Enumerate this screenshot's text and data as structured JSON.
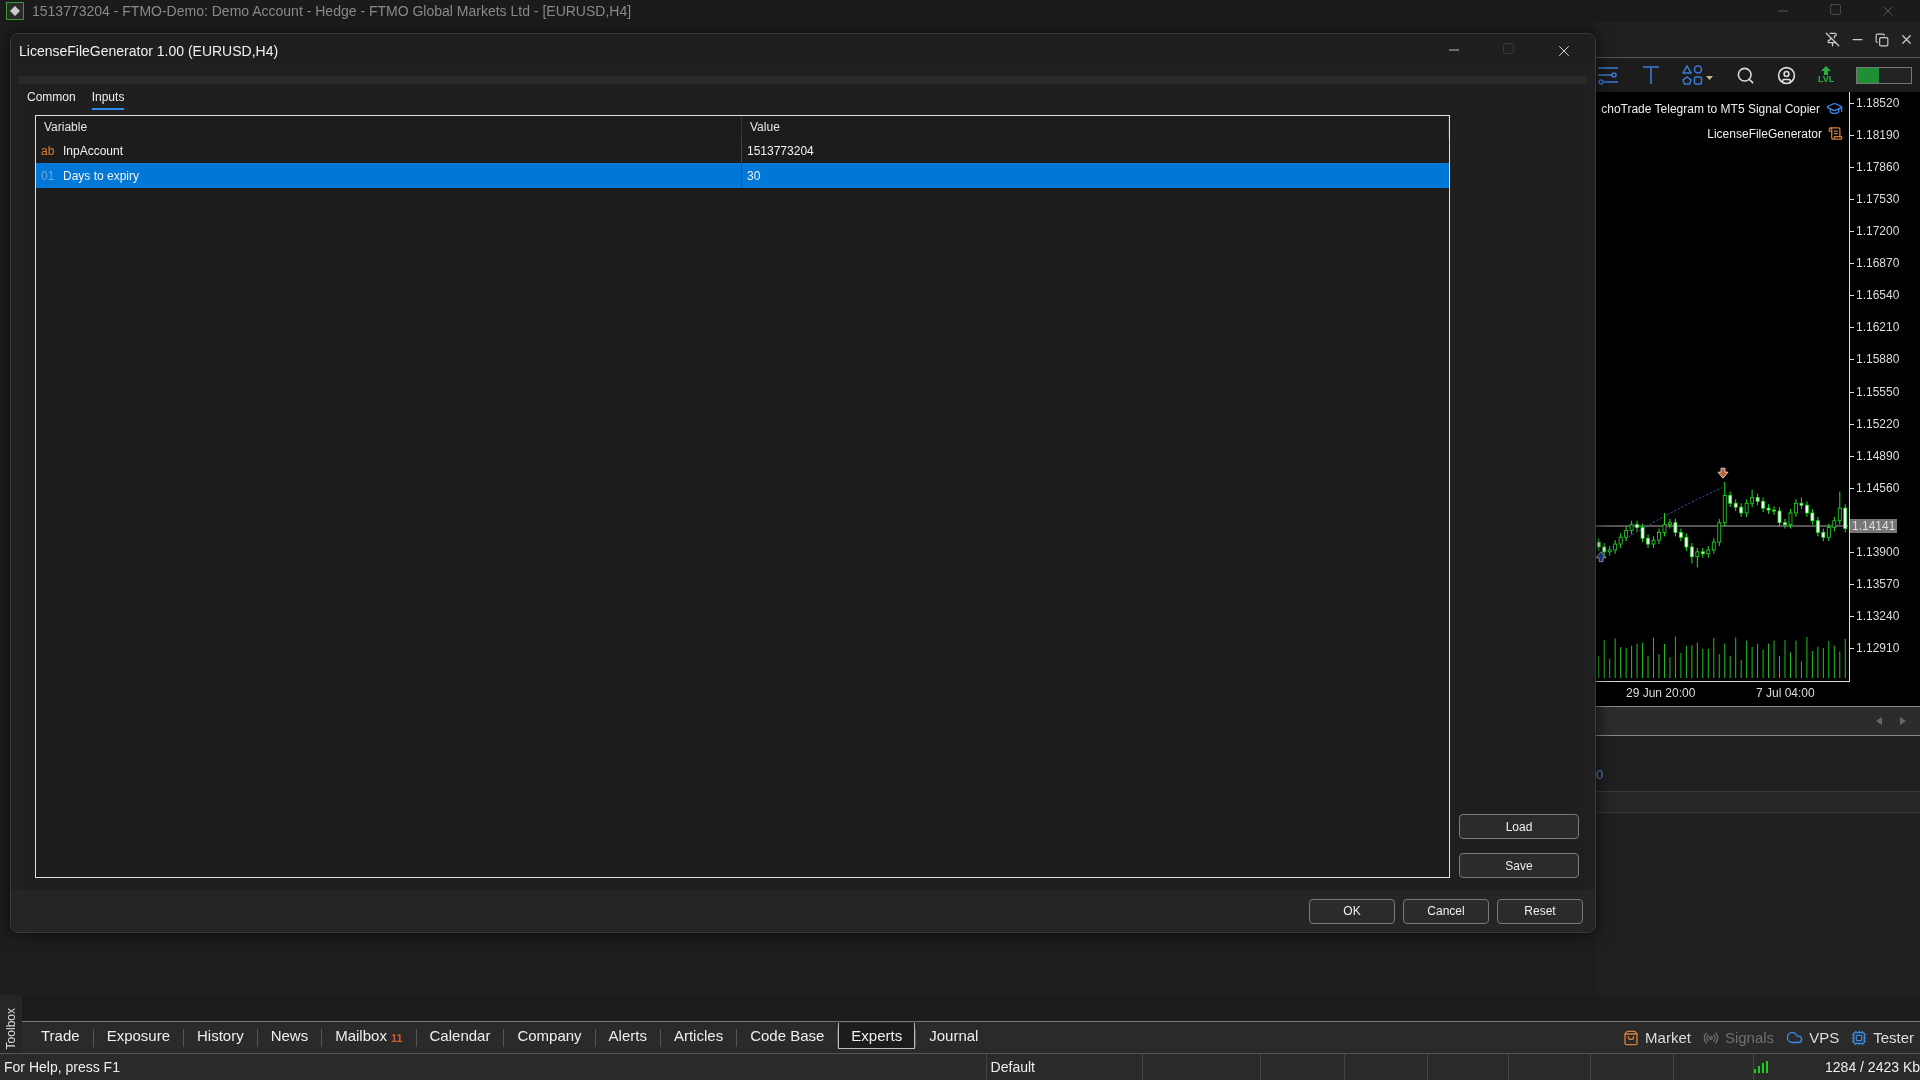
{
  "app_window": {
    "title": "1513773204 - FTMO-Demo: Demo Account - Hedge - FTMO Global Markets Ltd - [EURUSD,H4]"
  },
  "dialog": {
    "title": "LicenseFileGenerator 1.00 (EURUSD,H4)",
    "tabs": [
      {
        "label": "Common",
        "selected": false
      },
      {
        "label": "Inputs",
        "selected": true
      }
    ],
    "table": {
      "columns": [
        "Variable",
        "Value"
      ],
      "rows": [
        {
          "kind": "text",
          "type_label": "ab",
          "variable": "InpAccount",
          "value": "1513773204",
          "selected": false
        },
        {
          "kind": "integer",
          "type_label": "01",
          "variable": "Days to expiry",
          "value": "30",
          "selected": true
        }
      ]
    },
    "side_buttons": [
      "Load",
      "Save"
    ],
    "buttons": [
      "OK",
      "Cancel",
      "Reset"
    ]
  },
  "chart_window": {
    "toolbar": {
      "lvl_label": "LVL",
      "meter": {
        "level": 0.4
      }
    },
    "legend": [
      {
        "kind": "hat",
        "text": "choTrade Telegram to MT5 Signal Copier"
      },
      {
        "kind": "scroll",
        "text": "LicenseFileGenerator"
      }
    ],
    "time_axis": [
      "29 Jun 20:00",
      "7 Jul 04:00"
    ],
    "current_price": "1.14141",
    "chart_data": {
      "type": "candlestick",
      "ylim": [
        1.12581,
        1.18633
      ],
      "yticks": [
        {
          "value": 1.1852,
          "label": "1.18520"
        },
        {
          "value": 1.1819,
          "label": "1.18190"
        },
        {
          "value": 1.1786,
          "label": "1.17860"
        },
        {
          "value": 1.1753,
          "label": "1.17530"
        },
        {
          "value": 1.172,
          "label": "1.17200"
        },
        {
          "value": 1.1687,
          "label": "1.16870"
        },
        {
          "value": 1.1654,
          "label": "1.16540"
        },
        {
          "value": 1.1621,
          "label": "1.16210"
        },
        {
          "value": 1.1588,
          "label": "1.15880"
        },
        {
          "value": 1.1555,
          "label": "1.15550"
        },
        {
          "value": 1.1522,
          "label": "1.15220"
        },
        {
          "value": 1.1489,
          "label": "1.14890"
        },
        {
          "value": 1.1456,
          "label": "1.14560"
        },
        {
          "value": 1.139,
          "label": "1.13900"
        },
        {
          "value": 1.1357,
          "label": "1.13570"
        },
        {
          "value": 1.1324,
          "label": "1.13240"
        },
        {
          "value": 1.1291,
          "label": "1.12910"
        }
      ],
      "ohlc": [
        [
          1.14,
          1.1404,
          1.1391,
          1.1395
        ],
        [
          1.1395,
          1.1399,
          1.1386,
          1.139
        ],
        [
          1.139,
          1.1396,
          1.1386,
          1.1392
        ],
        [
          1.1392,
          1.1402,
          1.1388,
          1.1398
        ],
        [
          1.1398,
          1.1409,
          1.1394,
          1.1405
        ],
        [
          1.1405,
          1.1416,
          1.1401,
          1.1412
        ],
        [
          1.1412,
          1.1422,
          1.1408,
          1.1418
        ],
        [
          1.1418,
          1.1422,
          1.1411,
          1.1415
        ],
        [
          1.1415,
          1.1419,
          1.14,
          1.1404
        ],
        [
          1.1404,
          1.1408,
          1.1394,
          1.1398
        ],
        [
          1.1398,
          1.1406,
          1.1394,
          1.1402
        ],
        [
          1.1402,
          1.1414,
          1.1398,
          1.141
        ],
        [
          1.141,
          1.143,
          1.1406,
          1.1418
        ],
        [
          1.1418,
          1.1424,
          1.1414,
          1.142
        ],
        [
          1.142,
          1.1424,
          1.1406,
          1.141
        ],
        [
          1.141,
          1.1414,
          1.1401,
          1.1405
        ],
        [
          1.1405,
          1.1409,
          1.1391,
          1.1395
        ],
        [
          1.1395,
          1.1399,
          1.1378,
          1.1385
        ],
        [
          1.1385,
          1.1394,
          1.1374,
          1.139
        ],
        [
          1.139,
          1.1394,
          1.1384,
          1.1388
        ],
        [
          1.1388,
          1.1396,
          1.1384,
          1.1392
        ],
        [
          1.1392,
          1.1404,
          1.1388,
          1.14
        ],
        [
          1.14,
          1.1424,
          1.1396,
          1.142
        ],
        [
          1.142,
          1.1462,
          1.1416,
          1.1448
        ],
        [
          1.1448,
          1.1452,
          1.1436,
          1.144
        ],
        [
          1.144,
          1.1444,
          1.1432,
          1.1436
        ],
        [
          1.1436,
          1.144,
          1.1426,
          1.143
        ],
        [
          1.143,
          1.1444,
          1.1426,
          1.144
        ],
        [
          1.144,
          1.1454,
          1.1436,
          1.1446
        ],
        [
          1.1446,
          1.145,
          1.1438,
          1.1442
        ],
        [
          1.1442,
          1.1446,
          1.1431,
          1.1435
        ],
        [
          1.1435,
          1.1439,
          1.1429,
          1.1433
        ],
        [
          1.1433,
          1.1437,
          1.1428,
          1.1432
        ],
        [
          1.1432,
          1.1436,
          1.1416,
          1.142
        ],
        [
          1.142,
          1.1424,
          1.1414,
          1.1418
        ],
        [
          1.1418,
          1.1434,
          1.1414,
          1.143
        ],
        [
          1.143,
          1.1444,
          1.1426,
          1.144
        ],
        [
          1.144,
          1.1446,
          1.1434,
          1.1438
        ],
        [
          1.1438,
          1.1442,
          1.1426,
          1.143
        ],
        [
          1.143,
          1.1434,
          1.1418,
          1.1422
        ],
        [
          1.1422,
          1.1426,
          1.1406,
          1.141
        ],
        [
          1.141,
          1.1414,
          1.1401,
          1.1405
        ],
        [
          1.1405,
          1.1419,
          1.1401,
          1.1415
        ],
        [
          1.1415,
          1.1426,
          1.1411,
          1.1422
        ],
        [
          1.1422,
          1.1452,
          1.1418,
          1.1435
        ],
        [
          1.1435,
          1.1439,
          1.141,
          1.1414
        ]
      ]
    }
  },
  "lower_panel": {
    "value": "0"
  },
  "toolbox": {
    "label": "Toolbox",
    "tabs": [
      {
        "label": "Trade",
        "selected": false
      },
      {
        "label": "Exposure",
        "selected": false
      },
      {
        "label": "History",
        "selected": false
      },
      {
        "label": "News",
        "selected": false
      },
      {
        "label": "Mailbox",
        "badge": "11",
        "selected": false
      },
      {
        "label": "Calendar",
        "selected": false
      },
      {
        "label": "Company",
        "selected": false
      },
      {
        "label": "Alerts",
        "selected": false
      },
      {
        "label": "Articles",
        "selected": false
      },
      {
        "label": "Code Base",
        "selected": false
      },
      {
        "label": "Experts",
        "selected": true
      },
      {
        "label": "Journal",
        "selected": false
      }
    ],
    "services": [
      {
        "kind": "market",
        "label": "Market",
        "disabled": false
      },
      {
        "kind": "signals",
        "label": "Signals",
        "disabled": true
      },
      {
        "kind": "vps",
        "label": "VPS",
        "disabled": false
      },
      {
        "kind": "tester",
        "label": "Tester",
        "disabled": false
      }
    ]
  },
  "status_bar": {
    "help": "For Help, press F1",
    "profile": "Default",
    "traffic": "1284 / 2423 Kb"
  }
}
